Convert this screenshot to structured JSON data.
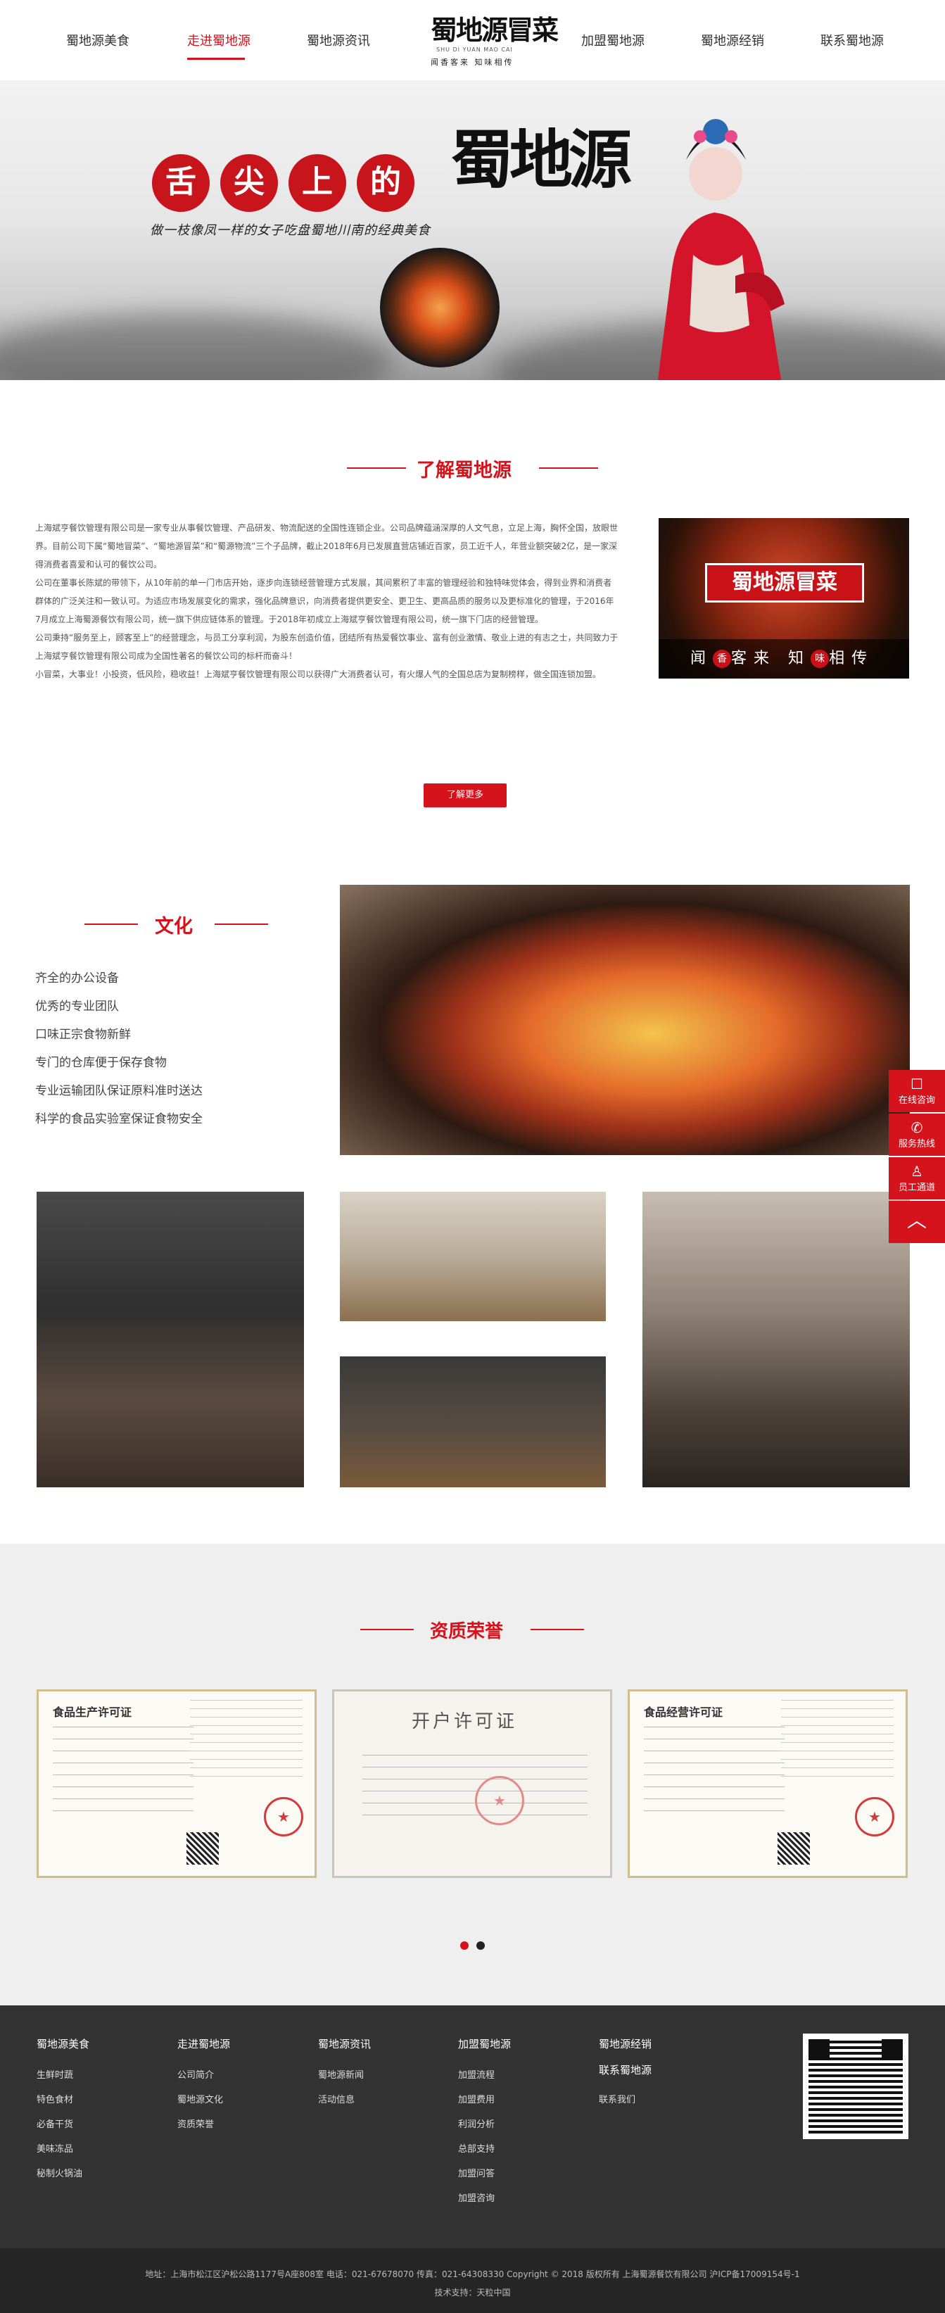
{
  "nav": {
    "items": [
      "蜀地源美食",
      "走进蜀地源",
      "蜀地源资讯",
      "加盟蜀地源",
      "蜀地源经销",
      "联系蜀地源"
    ],
    "active_index": 1
  },
  "logo": {
    "title": "蜀地源冒菜",
    "pinyin": "SHU DI YUAN MAO CAI",
    "subtitle": "闻香客来 知味相传"
  },
  "banner": {
    "circles": [
      "舌",
      "尖",
      "上",
      "的"
    ],
    "brand": "蜀地源",
    "slogan": "做一枝像凤一样的女子吃盘蜀地川南的经典美食"
  },
  "about": {
    "title": "了解蜀地源",
    "paragraphs": [
      "上海斌亨餐饮管理有限公司是一家专业从事餐饮管理、产品研发、物流配送的全国性连锁企业。公司品牌蕴涵深厚的人文气息，立足上海，胸怀全国，放眼世界。目前公司下属“蜀地冒菜”、“蜀地源冒菜”和“蜀源物流”三个子品牌，截止2018年6月已发展直营店铺近百家，员工近千人，年营业额突破2亿，是一家深得消费者喜爱和认可的餐饮公司。",
      "公司在董事长陈斌的带领下，从10年前的单一门市店开始，逐步向连锁经营管理方式发展，其间累积了丰富的管理经验和独特味觉体会，得到业界和消费者群体的广泛关注和一致认可。为适应市场发展变化的需求，强化品牌意识，向消费者提供更安全、更卫生、更高品质的服务以及更标准化的管理，于2016年7月成立上海蜀源餐饮有限公司，统一旗下供应链体系的管理。于2018年初成立上海斌亨餐饮管理有限公司，统一旗下门店的经营管理。",
      "公司秉持“服务至上，顾客至上”的经营理念，与员工分享利润，为股东创造价值，团结所有热爱餐饮事业、富有创业激情、敬业上进的有志之士，共同致力于上海斌亨餐饮管理有限公司成为全国性著名的餐饮公司的标杆而奋斗！",
      "小冒菜，大事业！小投资，低风险，稳收益！上海斌亨餐饮管理有限公司以获得广大消费者认可，有火爆人气的全国总店为复制榜样，做全国连锁加盟。"
    ],
    "image_banner": "蜀地源冒菜",
    "image_caption_chars": [
      "闻",
      "香",
      "客",
      "来",
      "知",
      "味",
      "相",
      "传"
    ],
    "more_button": "了解更多"
  },
  "culture": {
    "title": "文化",
    "items": [
      "齐全的办公设备",
      "优秀的专业团队",
      "口味正宗食物新鲜",
      "专门的仓库便于保存食物",
      "专业运输团队保证原料准时送达",
      "科学的食品实验室保证食物安全"
    ]
  },
  "honors": {
    "title": "资质荣誉",
    "certs": [
      "食品生产许可证",
      "开户许可证",
      "食品经营许可证"
    ]
  },
  "footer": {
    "columns": [
      {
        "title": "蜀地源美食",
        "links": [
          "生鲜时蔬",
          "特色食材",
          "必备干货",
          "美味冻品",
          "秘制火锅油"
        ]
      },
      {
        "title": "走进蜀地源",
        "links": [
          "公司简介",
          "蜀地源文化",
          "资质荣誉"
        ]
      },
      {
        "title": "蜀地源资讯",
        "links": [
          "蜀地源新闻",
          "活动信息"
        ]
      },
      {
        "title": "加盟蜀地源",
        "links": [
          "加盟流程",
          "加盟费用",
          "利润分析",
          "总部支持",
          "加盟问答",
          "加盟咨询"
        ]
      },
      {
        "title": "蜀地源经销",
        "links": []
      },
      {
        "title": "联系蜀地源",
        "links": [
          "联系我们"
        ]
      }
    ],
    "address_line": "地址：上海市松江区沪松公路1177号A座808室 电话：021-67678070 传真：021-64308330 Copyright © 2018 版权所有 上海蜀源餐饮有限公司 沪ICP备17009154号-1",
    "tech_support": "技术支持：天粒中国"
  },
  "side_float": {
    "items": [
      "在线咨询",
      "服务热线",
      "员工通道"
    ]
  },
  "colors": {
    "accent": "#d5131c",
    "footer_bg": "#333333",
    "copybar_bg": "#262626"
  }
}
